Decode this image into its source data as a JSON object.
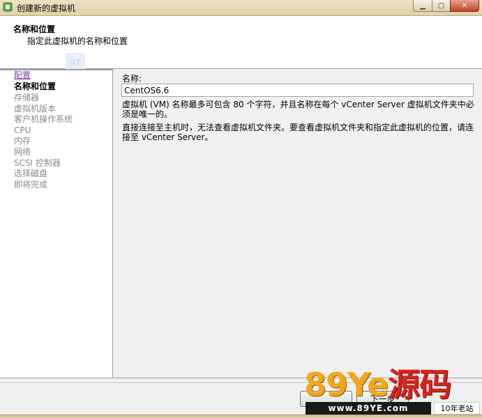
{
  "window": {
    "title": "创建新的虚拟机",
    "controls": {
      "minimize": "▁",
      "maximize": "▢",
      "close": "✕"
    }
  },
  "header": {
    "title": "名称和位置",
    "subtitle": "指定此虚拟机的名称和位置",
    "watermark_text": "97"
  },
  "sidebar": {
    "steps": [
      {
        "label": "配置",
        "state": "link"
      },
      {
        "label": "名称和位置",
        "state": "current"
      },
      {
        "label": "存储器",
        "state": "disabled"
      },
      {
        "label": "虚拟机版本",
        "state": "disabled"
      },
      {
        "label": "客户机操作系统",
        "state": "disabled"
      },
      {
        "label": "CPU",
        "state": "disabled"
      },
      {
        "label": "内存",
        "state": "disabled"
      },
      {
        "label": "网络",
        "state": "disabled"
      },
      {
        "label": "SCSI 控制器",
        "state": "disabled"
      },
      {
        "label": "选择磁盘",
        "state": "disabled"
      },
      {
        "label": "即将完成",
        "state": "disabled"
      }
    ]
  },
  "main": {
    "name_label": "名称:",
    "name_value": "CentOS6.6",
    "para1": "虚拟机 (VM) 名称最多可包含 80 个字符，并且名称在每个 vCenter Server 虚拟机文件夹中必须是唯一的。",
    "para2": "直接连接至主机时，无法查看虚拟机文件夹。要查看虚拟机文件夹和指定此虚拟机的位置，请连接至 vCenter Server。"
  },
  "footer": {
    "back_label": "",
    "next_label": "下一步"
  },
  "watermark": {
    "big_part1": "89Ye",
    "big_part2": "源码",
    "url": "www.89YE.com",
    "tag": "10年老站"
  },
  "colors": {
    "titlebar": "#e0d2a8",
    "link_step": "#7d3aa8",
    "disabled_step": "#8a8a8a",
    "watermark_orange": "#f2a71b",
    "watermark_red": "#d8231c"
  }
}
